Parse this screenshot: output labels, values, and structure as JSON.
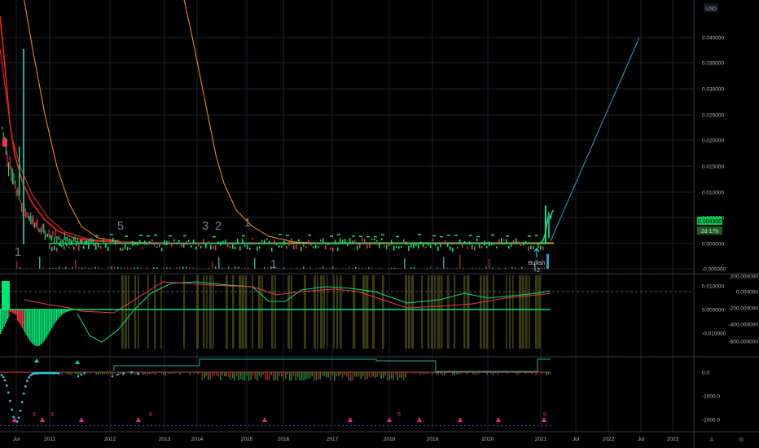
{
  "currency": "USD",
  "colors": {
    "background": "#000000",
    "up": "#22ab94",
    "down": "#f23645",
    "bright_green": "#00e676",
    "red_line": "#ff1a1a",
    "orange_line": "#ff9800",
    "trend_line": "#2aa1c4",
    "olive": "#6b6b1e",
    "magenta": "#e91e8c",
    "cyan": "#26c6da"
  },
  "price_pane": {
    "y_ticks": [
      "0.040000",
      "0.035000",
      "0.030000",
      "0.025000",
      "0.020000",
      "0.015000",
      "0.010000",
      "0.005000",
      "0.000000",
      "-0.005000"
    ],
    "last_price_label": "0.004300",
    "countdown_label": "2d 17h",
    "annotation": "Bullish\n+2",
    "big_numbers": [
      "1",
      "5",
      "3",
      "2",
      "1",
      "1"
    ]
  },
  "osc_pane": {
    "left_ticks": [
      "0.010000",
      "0.000000",
      "-0.010000"
    ],
    "right_ticks": [
      "200.000000",
      "0.000000",
      "-200.000000",
      "-400.000000",
      "-600.000000"
    ]
  },
  "bottom_pane": {
    "ticks": [
      "0.0",
      "-1000.0",
      "-2000.0"
    ],
    "nine_labels": [
      "9",
      "9",
      "9",
      "9",
      "9"
    ]
  },
  "x_axis": {
    "labels": [
      "Jul",
      "2011",
      "2012",
      "2013",
      "2014",
      "2015",
      "2016",
      "2017",
      "2018",
      "2019",
      "2020",
      "2021",
      "Jul",
      "2022",
      "Jul",
      "2023"
    ]
  },
  "chart_data": {
    "type": "line",
    "title": "",
    "xlabel": "",
    "ylabel": "USD",
    "ylim": [
      -0.005,
      0.042
    ],
    "x": [
      "2010-07",
      "2010-10",
      "2011-01",
      "2011-07",
      "2012-01",
      "2013-01",
      "2014-01",
      "2015-01",
      "2016-01",
      "2017-01",
      "2018-01",
      "2019-01",
      "2020-01",
      "2021-01",
      "2021-02"
    ],
    "series": [
      {
        "values": [
          0.045,
          0.018,
          0.006,
          0.002,
          0.0009,
          0.0005,
          0.0004,
          0.0003,
          0.0002,
          0.0003,
          0.0006,
          0.0003,
          0.0003,
          0.0008,
          0.0043
        ]
      },
      {
        "values": [
          0.042,
          0.02,
          0.009,
          0.003,
          0.0015,
          0.0008,
          0.0006,
          0.0004,
          0.0003,
          0.0004,
          0.0007,
          0.0004,
          0.0003,
          0.0006,
          0.003
        ]
      }
    ],
    "annotations": [
      "Bullish +2"
    ],
    "last_value": 0.0043
  }
}
